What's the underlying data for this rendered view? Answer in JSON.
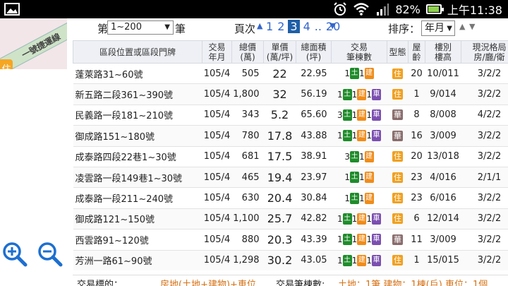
{
  "status_bar": {
    "battery": "82%",
    "battery_level": 0.82,
    "time": "上午11:38"
  },
  "map": {
    "road_label": "一號捷運線",
    "marker": "住"
  },
  "controls": {
    "di": "第",
    "range": "1~200",
    "bi": "筆",
    "pages_label": "頁次",
    "pages": [
      "1",
      "2",
      "3",
      "4",
      "..",
      "20"
    ],
    "active_page": "3",
    "sort_label": "排序：",
    "sort_value": "年月"
  },
  "table": {
    "headers": {
      "address": "區段位置或區段門牌",
      "date": "交易\n年月",
      "total": "總價\n(萬)",
      "unit": "單價\n(萬/坪)",
      "area": "總面積\n(坪)",
      "count": "交易\n筆棟數",
      "type": "型態",
      "age": "屋\n齡",
      "floor": "樓別\n樓高",
      "layout": "現況格局\n房/廳/衛"
    },
    "badge_labels": {
      "land": "土",
      "bldg": "建",
      "park": "車"
    },
    "rows": [
      {
        "addr": "蓬萊路31~60號",
        "date": "105/4",
        "total": "505",
        "unit": "22",
        "area": "22.95",
        "land": "1",
        "bldg": "1",
        "park": "",
        "type": "住",
        "age": "20",
        "floor": "10/011",
        "layout": "3/2/2"
      },
      {
        "addr": "新五路二段361~390號",
        "date": "105/4",
        "total": "1,800",
        "unit": "32",
        "area": "56.19",
        "land": "1",
        "bldg": "1",
        "park": "1",
        "type": "住",
        "age": "1",
        "floor": "9/014",
        "layout": "3/2/2"
      },
      {
        "addr": "民義路一段181~210號",
        "date": "105/4",
        "total": "343",
        "unit": "5.2",
        "area": "65.60",
        "land": "3",
        "bldg": "1",
        "park": "1",
        "type": "華",
        "age": "8",
        "floor": "8/008",
        "layout": "4/2/2"
      },
      {
        "addr": "御成路151~180號",
        "date": "105/4",
        "total": "780",
        "unit": "17.8",
        "area": "43.88",
        "land": "1",
        "bldg": "1",
        "park": "1",
        "type": "華",
        "age": "16",
        "floor": "3/009",
        "layout": "3/2/2"
      },
      {
        "addr": "成泰路四段22巷1~30號",
        "date": "105/4",
        "total": "681",
        "unit": "17.5",
        "area": "38.91",
        "land": "3",
        "bldg": "1",
        "park": "",
        "type": "住",
        "age": "20",
        "floor": "13/018",
        "layout": "3/2/2"
      },
      {
        "addr": "凌雲路一段149巷1~30號",
        "date": "105/4",
        "total": "465",
        "unit": "19.4",
        "area": "23.97",
        "land": "1",
        "bldg": "1",
        "park": "",
        "type": "住",
        "age": "23",
        "floor": "4/016",
        "layout": "2/1/1"
      },
      {
        "addr": "成泰路一段211~240號",
        "date": "105/4",
        "total": "630",
        "unit": "20.4",
        "area": "30.84",
        "land": "1",
        "bldg": "1",
        "park": "",
        "type": "住",
        "age": "23",
        "floor": "6/016",
        "layout": "3/2/2"
      },
      {
        "addr": "御成路121~150號",
        "date": "105/4",
        "total": "1,100",
        "unit": "25.7",
        "area": "42.82",
        "land": "1",
        "bldg": "1",
        "park": "1",
        "type": "住",
        "age": "6",
        "floor": "12/014",
        "layout": "3/2/2"
      },
      {
        "addr": "西雲路91~120號",
        "date": "105/4",
        "total": "880",
        "unit": "20.3",
        "area": "43.39",
        "land": "1",
        "bldg": "1",
        "park": "1",
        "type": "華",
        "age": "11",
        "floor": "3/009",
        "layout": "3/2/2"
      },
      {
        "addr": "芳洲一路61~90號",
        "date": "105/4",
        "total": "1,298",
        "unit": "30.2",
        "area": "43.05",
        "land": "1",
        "bldg": "1",
        "park": "1",
        "type": "住",
        "age": "1",
        "floor": "15/015",
        "layout": "3/2/2"
      }
    ]
  },
  "footer": {
    "label1": "交易標的：",
    "value1": "房地(土地+建物)+車位",
    "label2": "交易筆棟數:",
    "value2": "土地：1筆 建物：1棟(戶) 車位：1個"
  }
}
